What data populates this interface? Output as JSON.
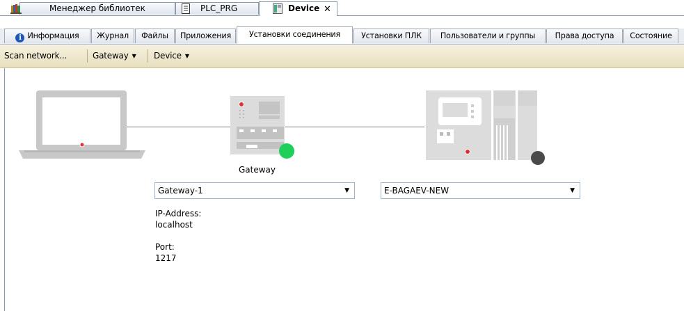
{
  "doc_tabs": [
    {
      "label": "Менеджер библиотек",
      "icon": "library-icon"
    },
    {
      "label": "PLC_PRG",
      "icon": "document-icon"
    },
    {
      "label": "Device",
      "icon": "device-icon",
      "close": "✕"
    }
  ],
  "sub_tabs": [
    {
      "label": "Информация"
    },
    {
      "label": "Журнал"
    },
    {
      "label": "Файлы"
    },
    {
      "label": "Приложения"
    },
    {
      "label": "Установки соединения"
    },
    {
      "label": "Установки ПЛК"
    },
    {
      "label": "Пользователи и группы"
    },
    {
      "label": "Права доступа"
    },
    {
      "label": "Состояние"
    }
  ],
  "toolbar": {
    "scan_label": "Scan network...",
    "gateway_label": "Gateway",
    "device_label": "Device"
  },
  "gateway": {
    "title": "Gateway",
    "selected": "Gateway-1",
    "ip_label": "IP-Address:",
    "ip_value": "localhost",
    "port_label": "Port:",
    "port_value": "1217",
    "status_color": "#1ed05a"
  },
  "device": {
    "selected": "E-BAGAEV-NEW",
    "status_color": "#4a4a4a"
  }
}
